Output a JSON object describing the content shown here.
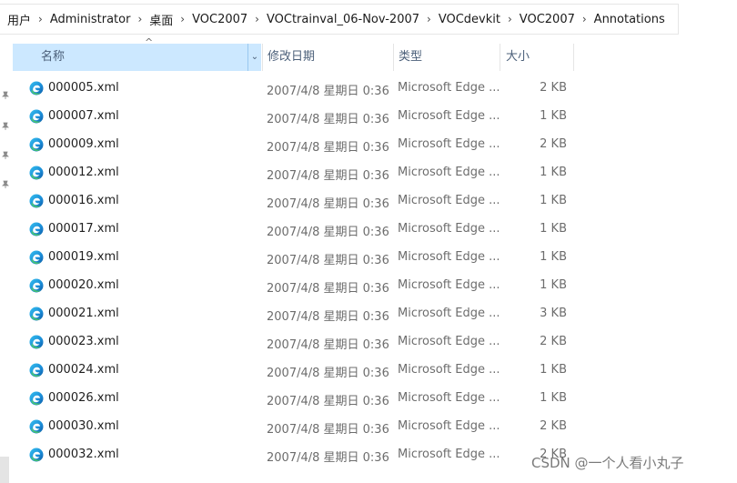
{
  "breadcrumb": [
    "用户",
    "Administrator",
    "桌面",
    "VOC2007",
    "VOCtrainval_06-Nov-2007",
    "VOCdevkit",
    "VOC2007",
    "Annotations"
  ],
  "breadcrumb_separator": "›",
  "columns": {
    "name": "名称",
    "date": "修改日期",
    "type": "类型",
    "size": "大小"
  },
  "sort_indicator": "^",
  "dropdown_glyph": "⌄",
  "files": [
    {
      "name": "000005.xml",
      "date": "2007/4/8 星期日 0:36",
      "type": "Microsoft Edge ...",
      "size": "2 KB"
    },
    {
      "name": "000007.xml",
      "date": "2007/4/8 星期日 0:36",
      "type": "Microsoft Edge ...",
      "size": "1 KB"
    },
    {
      "name": "000009.xml",
      "date": "2007/4/8 星期日 0:36",
      "type": "Microsoft Edge ...",
      "size": "2 KB"
    },
    {
      "name": "000012.xml",
      "date": "2007/4/8 星期日 0:36",
      "type": "Microsoft Edge ...",
      "size": "1 KB"
    },
    {
      "name": "000016.xml",
      "date": "2007/4/8 星期日 0:36",
      "type": "Microsoft Edge ...",
      "size": "1 KB"
    },
    {
      "name": "000017.xml",
      "date": "2007/4/8 星期日 0:36",
      "type": "Microsoft Edge ...",
      "size": "1 KB"
    },
    {
      "name": "000019.xml",
      "date": "2007/4/8 星期日 0:36",
      "type": "Microsoft Edge ...",
      "size": "1 KB"
    },
    {
      "name": "000020.xml",
      "date": "2007/4/8 星期日 0:36",
      "type": "Microsoft Edge ...",
      "size": "1 KB"
    },
    {
      "name": "000021.xml",
      "date": "2007/4/8 星期日 0:36",
      "type": "Microsoft Edge ...",
      "size": "3 KB"
    },
    {
      "name": "000023.xml",
      "date": "2007/4/8 星期日 0:36",
      "type": "Microsoft Edge ...",
      "size": "2 KB"
    },
    {
      "name": "000024.xml",
      "date": "2007/4/8 星期日 0:36",
      "type": "Microsoft Edge ...",
      "size": "1 KB"
    },
    {
      "name": "000026.xml",
      "date": "2007/4/8 星期日 0:36",
      "type": "Microsoft Edge ...",
      "size": "1 KB"
    },
    {
      "name": "000030.xml",
      "date": "2007/4/8 星期日 0:36",
      "type": "Microsoft Edge ...",
      "size": "2 KB"
    },
    {
      "name": "000032.xml",
      "date": "2007/4/8 星期日 0:36",
      "type": "Microsoft Edge ...",
      "size": "2 KB"
    }
  ],
  "watermark": "CSDN @一个人看小丸子",
  "icons": {
    "file": "edge-icon",
    "pin": "pin-icon"
  },
  "colors": {
    "header_selected": "#cce8ff",
    "text_secondary": "#6d6d6d",
    "header_text": "#4c607a"
  }
}
